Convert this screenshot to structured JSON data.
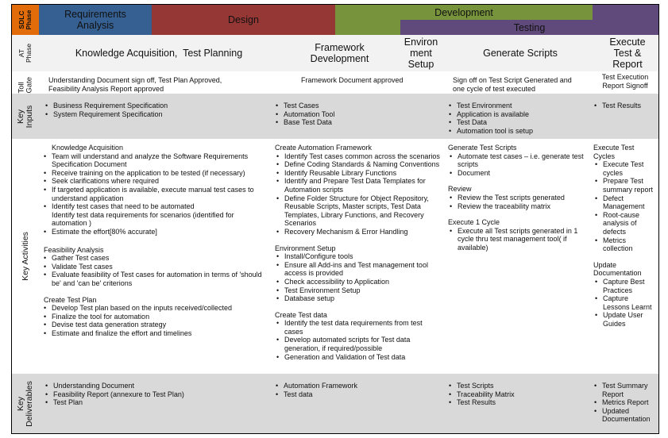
{
  "colors": {
    "sdlc_label_bg": "#e36c0a",
    "requirements": "#366092",
    "design": "#953735",
    "development": "#77933c",
    "testing": "#604a7b",
    "at_phase_bg": "#f2f2f2",
    "gray_row_bg": "#d9d9d9",
    "white_row_bg": "#ffffff"
  },
  "sdlc": {
    "label": "SDLC Phase",
    "phases": [
      {
        "name": "Requirements Analysis"
      },
      {
        "name": "Design"
      },
      {
        "name": "Development"
      },
      {
        "name": "Testing"
      }
    ]
  },
  "at_phase": {
    "label": "AT Phase",
    "phases": [
      "Knowledge Acquisition,  Test Planning",
      "Framework Development",
      "Environ ment Setup",
      "Generate Scripts",
      "Execute Test & Report"
    ]
  },
  "toll_gate": {
    "label": "Toll Gate",
    "values": [
      "Understanding Document sign off, Test Plan Approved, Feasibility Analysis Report approved",
      "Framework Document approved",
      "Sign off on Test Script Generated and one cycle of test executed",
      "Test Execution Report Signoff"
    ]
  },
  "key_inputs": {
    "label": "Key Inputs",
    "columns": [
      [
        "Business Requirement Specification",
        "System Requirement Specification"
      ],
      [
        "Test Cases",
        "Automation Tool",
        "Base Test Data"
      ],
      [
        "Test Environment",
        "Application is available",
        "Test Data",
        "Automation tool is setup"
      ],
      [
        "Test Results"
      ]
    ]
  },
  "key_activities": {
    "label": "Key Activities",
    "columns": [
      [
        {
          "title": "Knowledge Acquisition",
          "items": [
            "Team will understand and analyze the Software Requirements Specification Document",
            "Receive training on the application to be tested (if necessary)",
            "Seek clarifications where required",
            "If targeted application is available, execute manual test cases to understand application",
            "Identify test cases that need to be automated",
            "Estimate the effort[80% accurate]"
          ],
          "continuation": "Identify test data requirements for scenarios (identified for automation )"
        },
        {
          "title": "Feasibility Analysis",
          "items": [
            "Gather Test cases",
            "Validate Test cases",
            "Evaluate feasibility of Test cases for automation in terms of 'should be' and 'can be' criterions"
          ]
        },
        {
          "title": "Create Test Plan",
          "items": [
            "Develop Test plan based on the inputs received/collected",
            "Finalize the tool for automation",
            "Devise test data generation strategy",
            "Estimate and finalize the effort and timelines"
          ]
        }
      ],
      [
        {
          "title": "Create Automation Framework",
          "items": [
            "Identify Test cases common across the scenarios",
            "Define Coding Standards & Naming Conventions",
            "Identify Reusable Library Functions",
            "Identify and Prepare Test Data Templates for Automation scripts",
            "Define Folder Structure  for Object Repository, Reusable Scripts, Master scripts, Test Data Templates, Library Functions, and Recovery Scenarios",
            "Recovery Mechanism & Error Handling"
          ]
        },
        {
          "title": "Environment Setup",
          "items": [
            "Install/Configure tools",
            "Ensure all Add-ins and Test management tool access is provided",
            "Check accessibility to Application",
            "Test Environment Setup",
            "Database setup"
          ]
        },
        {
          "title": "Create Test data",
          "items": [
            "Identify the test data requirements from test cases",
            "Develop automated scripts for Test data generation, if required/possible",
            "Generation and Validation of Test data"
          ]
        }
      ],
      [
        {
          "title": "Generate Test Scripts",
          "items": [
            "Automate test cases – i.e. generate test scripts",
            "Document"
          ]
        },
        {
          "title": "Review",
          "items": [
            "Review the Test scripts generated",
            "Review the traceability matrix"
          ]
        },
        {
          "title": "Execute 1 Cycle",
          "items": [
            "Execute all Test scripts generated in 1 cycle thru test management tool( if available)"
          ]
        }
      ],
      [
        {
          "title": "Execute Test Cycles",
          "items": [
            "Execute Test cycles",
            "Prepare Test summary report",
            "Defect Management",
            "Root-cause analysis of defects",
            "Metrics collection"
          ]
        },
        {
          "title": "Update Documentation",
          "items": [
            "Capture Best Practices",
            "Capture Lessons Learnt",
            "Update User Guides"
          ]
        }
      ]
    ]
  },
  "key_deliverables": {
    "label": "Key Deliverables",
    "columns": [
      [
        "Understanding Document",
        "Feasibility Report (annexure to Test Plan)",
        "Test Plan"
      ],
      [
        "Automation Framework",
        "Test data"
      ],
      [
        "Test Scripts",
        "Traceability Matrix",
        "Test Results"
      ],
      [
        "Test Summary Report",
        "Metrics Report",
        "Updated Documentation"
      ]
    ]
  }
}
